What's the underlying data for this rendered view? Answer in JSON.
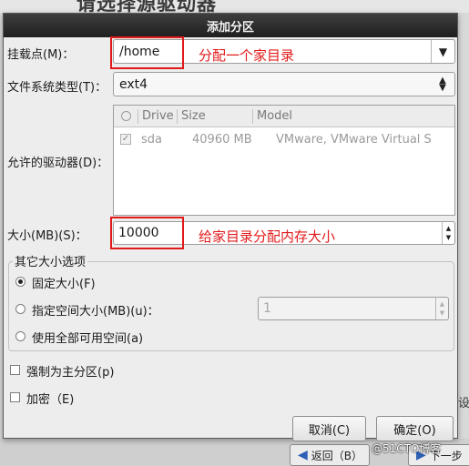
{
  "background": {
    "page_title": "请选择源驱动器",
    "back_button": "返回（B）",
    "next_button": "下一步",
    "side_text": "设",
    "watermark": "@51CTO博客"
  },
  "dialog": {
    "title": "添加分区",
    "mount_point": {
      "label": "挂载点(M)：",
      "value": "/home",
      "annotation": "分配一个家目录"
    },
    "fs_type": {
      "label": "文件系统类型(T)：",
      "value": "ext4"
    },
    "drives": {
      "label": "允许的驱动器(D)：",
      "columns": [
        "Drive",
        "Size",
        "Model"
      ],
      "rows": [
        {
          "drive": "sda",
          "size": "40960 MB",
          "model": "VMware, VMware Virtual S"
        }
      ]
    },
    "size": {
      "label": "大小(MB)(S)：",
      "value": "10000",
      "annotation": "给家目录分配内存大小"
    },
    "size_options": {
      "title": "其它大小选项",
      "fixed": "固定大小(F)",
      "up_to": "指定空间大小(MB)(u)：",
      "up_to_value": "1",
      "fill_all": "使用全部可用空间(a)",
      "selected": "fixed"
    },
    "force_primary": "强制为主分区(p)",
    "encrypt": "加密（E)",
    "cancel_button": "取消(C)",
    "ok_button": "确定(O)"
  },
  "colors": {
    "annotation": "#e11a1a"
  }
}
